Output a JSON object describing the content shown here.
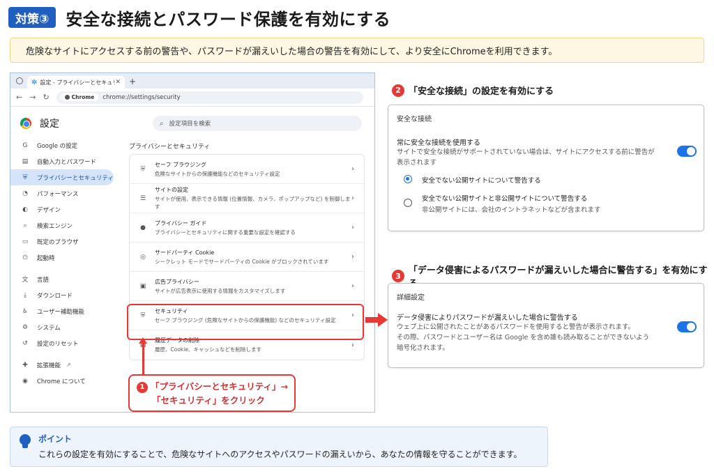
{
  "header": {
    "badge": "対策③",
    "title": "安全な接続とパスワード保護を有効にする",
    "lead": "危険なサイトにアクセスする前の警告や、パスワードが漏えいした場合の警告を有効にして、より安全にChromeを利用できます。"
  },
  "browser": {
    "tab_title": "設定 - プライバシーとセキュリティ",
    "tab_close": "✕",
    "new_tab": "+",
    "chip_label": "Chrome",
    "url": "chrome://settings/security",
    "settings_title": "設定",
    "search_placeholder": "設定項目を検索",
    "sidebar": [
      {
        "label": "Google の設定",
        "icon": "G"
      },
      {
        "label": "自動入力とパスワード",
        "icon": "▤"
      },
      {
        "label": "プライバシーとセキュリティ",
        "icon": "⛨"
      },
      {
        "label": "パフォーマンス",
        "icon": "◔"
      },
      {
        "label": "デザイン",
        "icon": "◐"
      },
      {
        "label": "検索エンジン",
        "icon": "⌕"
      },
      {
        "label": "既定のブラウザ",
        "icon": "▭"
      },
      {
        "label": "起動時",
        "icon": "⏻"
      },
      {
        "label": "言語",
        "icon": "文"
      },
      {
        "label": "ダウンロード",
        "icon": "⤓"
      },
      {
        "label": "ユーザー補助機能",
        "icon": "♿"
      },
      {
        "label": "システム",
        "icon": "⚙"
      },
      {
        "label": "設定のリセット",
        "icon": "↺"
      },
      {
        "label": "拡張機能",
        "icon": "✚"
      },
      {
        "label": "Chrome について",
        "icon": "◉"
      }
    ],
    "ext_link_icon": "↗",
    "section_label": "プライバシーとセキュリティ",
    "rows": [
      {
        "title": "セーフ ブラウジング",
        "desc": "危険なサイトからの保護機能などのセキュリティ設定",
        "icon": "⛨"
      },
      {
        "title": "サイトの設定",
        "desc": "サイトが使用、表示できる情報 (位置情報、カメラ、ポップアップなど) を制御します",
        "icon": "☰"
      },
      {
        "title": "プライバシー ガイド",
        "desc": "プライバシーとセキュリティに関する重要な設定を確認する",
        "icon": "●"
      },
      {
        "title": "サードパーティ Cookie",
        "desc": "シークレット モードでサードパーティの Cookie がブロックされています",
        "icon": "◎"
      },
      {
        "title": "広告プライバシー",
        "desc": "サイトが広告表示に使用する情報をカスタマイズします",
        "icon": "▣"
      },
      {
        "title": "セキュリティ",
        "desc": "セーフ ブラウジング (危険なサイトからの保護機能) などのセキュリティ設定",
        "icon": "⛨"
      },
      {
        "title": "履歴データの削除",
        "desc": "履歴、Cookie、キャッシュなどを削除します",
        "icon": "▦"
      }
    ],
    "chevron": "›"
  },
  "callout1": {
    "num": "1",
    "line1": "「プライバシーとセキュリティ」→",
    "line2": "「セキュリティ」をクリック"
  },
  "step2": {
    "num": "2",
    "heading": "「安全な接続」の設定を有効にする",
    "panel_title": "安全な接続",
    "option_title": "常に安全な接続を使用する",
    "option_desc1": "サイトで安全な接続がサポートされていない場合は、サイトにアクセスする前に警告が",
    "option_desc2": "表示されます",
    "radio1": "安全でない公開サイトについて警告する",
    "radio2": "安全でない公開サイトと非公開サイトについて警告する",
    "radio2_sub": "非公開サイトには、会社のイントラネットなどが含まれます"
  },
  "step3": {
    "num": "3",
    "heading": "「データ侵害によるパスワードが漏えいした場合に警告する」を有効にする",
    "panel_title": "詳細設定",
    "option_title": "データ侵害によりパスワードが漏えいした場合に警告する",
    "desc1": "ウェブ上に公開されたことがあるパスワードを使用すると警告が表示されます。",
    "desc2": "その際、パスワードとユーザー名は Google を含め誰も読み取ることができないよう",
    "desc3": "暗号化されます。"
  },
  "point": {
    "label": "ポイント",
    "text": "これらの設定を有効にすることで、危険なサイトへのアクセスやパスワードの漏えいから、あなたの情報を守ることができます。"
  },
  "colors": {
    "accent_blue": "#1f5fbf",
    "highlight_red": "#e53935",
    "toggle_blue": "#1a73e8"
  }
}
